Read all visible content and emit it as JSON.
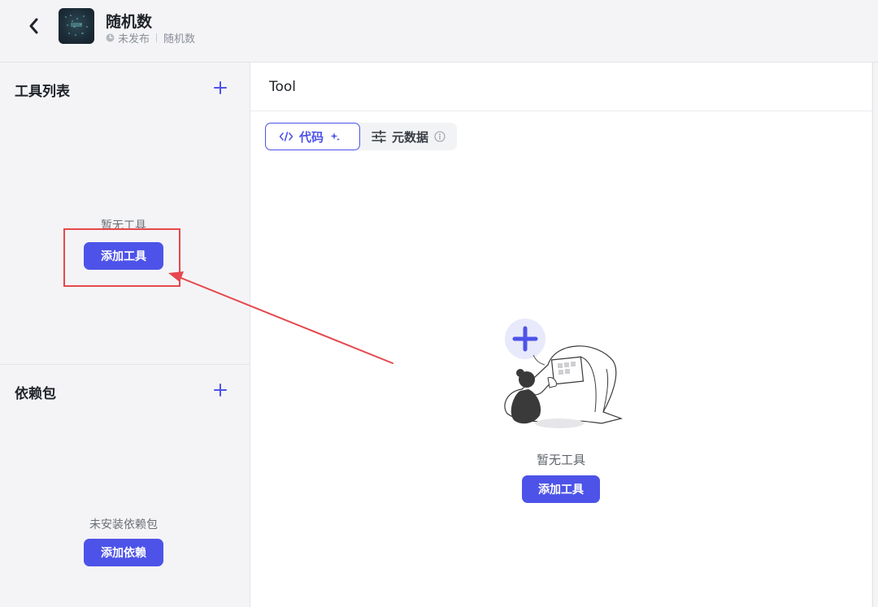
{
  "header": {
    "title": "随机数",
    "status": "未发布",
    "category": "随机数"
  },
  "left": {
    "tools": {
      "title": "工具列表",
      "empty_text": "暂无工具",
      "add_button": "添加工具"
    },
    "deps": {
      "title": "依赖包",
      "empty_text": "未安装依赖包",
      "add_button": "添加依赖"
    }
  },
  "main": {
    "title": "Tool",
    "tabs": [
      {
        "label": "代码",
        "icon": "code-icon",
        "active": true
      },
      {
        "label": "元数据",
        "icon": "sliders-icon",
        "active": false
      }
    ],
    "empty_text": "暂无工具",
    "add_button": "添加工具"
  },
  "colors": {
    "primary": "#4d53e8",
    "annotation": "#e5484d"
  }
}
